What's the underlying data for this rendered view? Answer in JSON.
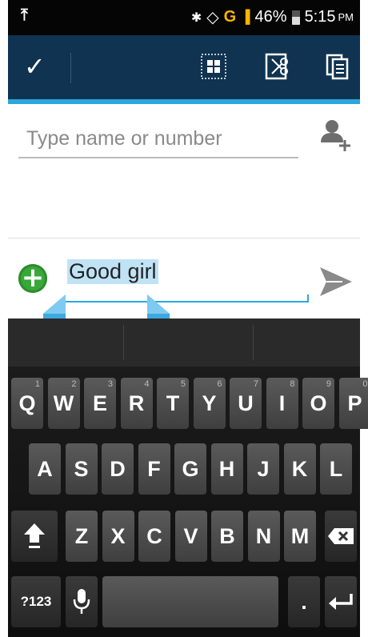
{
  "status_bar": {
    "battery": "46%",
    "time": "5:15",
    "ampm": "PM",
    "network": "G"
  },
  "action_bar": {
    "done_icon": "check-icon",
    "icons": [
      "select-all-icon",
      "cut-icon",
      "copy-icon"
    ]
  },
  "recipient": {
    "placeholder": "Type name or number"
  },
  "compose": {
    "text": "Good girl"
  },
  "keyboard": {
    "row1": [
      {
        "label": "Q",
        "hint": "1"
      },
      {
        "label": "W",
        "hint": "2"
      },
      {
        "label": "E",
        "hint": "3"
      },
      {
        "label": "R",
        "hint": "4"
      },
      {
        "label": "T",
        "hint": "5"
      },
      {
        "label": "Y",
        "hint": "6"
      },
      {
        "label": "U",
        "hint": "7"
      },
      {
        "label": "I",
        "hint": "8"
      },
      {
        "label": "O",
        "hint": "9"
      },
      {
        "label": "P",
        "hint": "0"
      }
    ],
    "row2": [
      "A",
      "S",
      "D",
      "F",
      "G",
      "H",
      "J",
      "K",
      "L"
    ],
    "row3": [
      "Z",
      "X",
      "C",
      "V",
      "B",
      "N",
      "M"
    ],
    "symbols_label": "?123",
    "period_label": "."
  }
}
